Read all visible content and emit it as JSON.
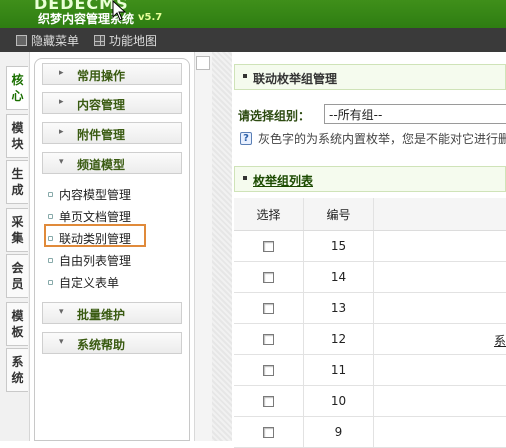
{
  "header": {
    "logo_text": "DEDECMS",
    "logo_subtitle": "织梦内容管理系统",
    "version": "v5.7"
  },
  "menubar": {
    "hide_menu": "隐藏菜单",
    "site_map": "功能地图"
  },
  "vertical_tabs": [
    {
      "label": "核心"
    },
    {
      "label": "模块"
    },
    {
      "label": "生成"
    },
    {
      "label": "采集"
    },
    {
      "label": "会员"
    },
    {
      "label": "模板"
    },
    {
      "label": "系统"
    }
  ],
  "left_menu": {
    "sections": [
      {
        "label": "常用操作",
        "expanded": false
      },
      {
        "label": "内容管理",
        "expanded": false
      },
      {
        "label": "附件管理",
        "expanded": false
      },
      {
        "label": "频道模型",
        "expanded": true
      },
      {
        "label": "批量维护",
        "expanded": false
      },
      {
        "label": "系统帮助",
        "expanded": false
      }
    ],
    "channel_items": [
      {
        "label": "内容模型管理"
      },
      {
        "label": "单页文档管理"
      },
      {
        "label": "联动类别管理"
      },
      {
        "label": "自由列表管理"
      },
      {
        "label": "自定义表单"
      }
    ]
  },
  "main": {
    "title": "联动枚举组管理",
    "filter_label": "请选择组别：",
    "group_select_value": "--所有组--",
    "notice": "灰色字的为系统内置枚举，您是不能对它进行删",
    "list_title": "枚举组列表",
    "table": {
      "headers": [
        "选择",
        "编号"
      ],
      "rows": [
        {
          "id": "15"
        },
        {
          "id": "14"
        },
        {
          "id": "13"
        },
        {
          "id": "12",
          "extra": "系"
        },
        {
          "id": "11"
        },
        {
          "id": "10"
        },
        {
          "id": "9"
        }
      ]
    }
  }
}
